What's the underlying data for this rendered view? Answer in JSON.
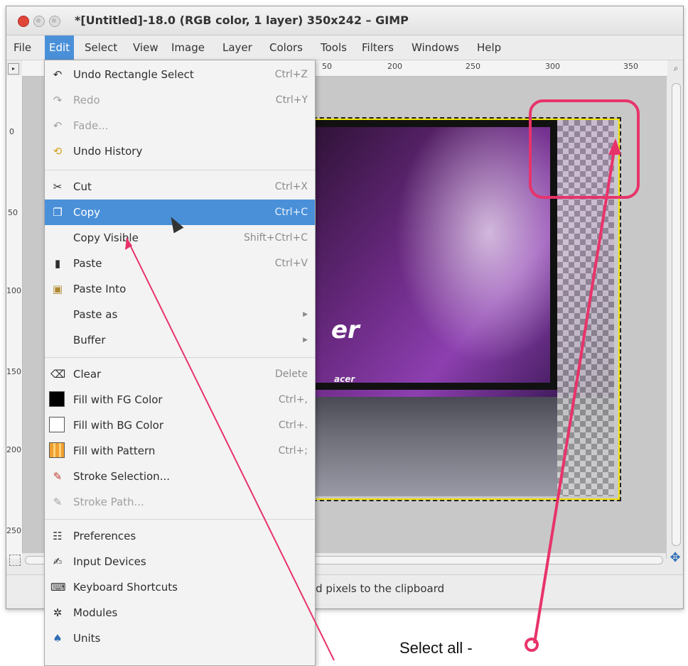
{
  "window": {
    "title": "*[Untitled]-18.0 (RGB color, 1 layer) 350x242 – GIMP"
  },
  "menubar": {
    "items": [
      {
        "label": "File"
      },
      {
        "label": "Edit"
      },
      {
        "label": "Select"
      },
      {
        "label": "View"
      },
      {
        "label": "Image"
      },
      {
        "label": "Layer"
      },
      {
        "label": "Colors"
      },
      {
        "label": "Tools"
      },
      {
        "label": "Filters"
      },
      {
        "label": "Windows"
      },
      {
        "label": "Help"
      }
    ],
    "active": "Edit"
  },
  "ruler": {
    "top_labels": [
      "50",
      "200",
      "250",
      "300",
      "350"
    ],
    "left_labels": [
      "0",
      "50",
      "100",
      "150",
      "200",
      "250"
    ]
  },
  "edit_menu": {
    "items": [
      {
        "label": "Undo Rectangle Select",
        "shortcut": "Ctrl+Z",
        "icon": "undo-icon",
        "enabled": true
      },
      {
        "label": "Redo",
        "shortcut": "Ctrl+Y",
        "icon": "redo-icon",
        "enabled": false
      },
      {
        "label": "Fade...",
        "shortcut": "",
        "icon": "fade-icon",
        "enabled": false
      },
      {
        "label": "Undo History",
        "shortcut": "",
        "icon": "undo-history-icon",
        "enabled": true
      },
      {
        "label": "Cut",
        "shortcut": "Ctrl+X",
        "icon": "scissors-icon",
        "enabled": true
      },
      {
        "label": "Copy",
        "shortcut": "Ctrl+C",
        "icon": "copy-icon",
        "enabled": true,
        "highlighted": true
      },
      {
        "label": "Copy Visible",
        "shortcut": "Shift+Ctrl+C",
        "icon": "",
        "enabled": true
      },
      {
        "label": "Paste",
        "shortcut": "Ctrl+V",
        "icon": "paste-icon",
        "enabled": true
      },
      {
        "label": "Paste Into",
        "shortcut": "",
        "icon": "paste-into-icon",
        "enabled": true
      },
      {
        "label": "Paste as",
        "shortcut": "",
        "icon": "",
        "enabled": true,
        "submenu": true
      },
      {
        "label": "Buffer",
        "shortcut": "",
        "icon": "",
        "enabled": true,
        "submenu": true
      },
      {
        "label": "Clear",
        "shortcut": "Delete",
        "icon": "clear-icon",
        "enabled": true
      },
      {
        "label": "Fill with FG Color",
        "shortcut": "Ctrl+,",
        "icon": "fg-color-swatch-icon",
        "enabled": true
      },
      {
        "label": "Fill with BG Color",
        "shortcut": "Ctrl+.",
        "icon": "bg-color-swatch-icon",
        "enabled": true
      },
      {
        "label": "Fill with Pattern",
        "shortcut": "Ctrl+;",
        "icon": "pattern-swatch-icon",
        "enabled": true
      },
      {
        "label": "Stroke Selection...",
        "shortcut": "",
        "icon": "stroke-selection-icon",
        "enabled": true
      },
      {
        "label": "Stroke Path...",
        "shortcut": "",
        "icon": "stroke-path-icon",
        "enabled": false
      },
      {
        "label": "Preferences",
        "shortcut": "",
        "icon": "preferences-icon",
        "enabled": true
      },
      {
        "label": "Input Devices",
        "shortcut": "",
        "icon": "input-devices-icon",
        "enabled": true
      },
      {
        "label": "Keyboard Shortcuts",
        "shortcut": "",
        "icon": "keyboard-icon",
        "enabled": true
      },
      {
        "label": "Modules",
        "shortcut": "",
        "icon": "gear-icon",
        "enabled": true
      },
      {
        "label": "Units",
        "shortcut": "",
        "icon": "units-icon",
        "enabled": true
      }
    ]
  },
  "canvas": {
    "image_logo_text": "er",
    "image_brand_text": "acer"
  },
  "statusbar": {
    "text": "ted pixels to the clipboard"
  },
  "annotation": {
    "text": "Select all  -",
    "color": "#e8336a"
  },
  "colors": {
    "menu_highlight": "#4a90d9",
    "annotation": "#e8336a"
  }
}
